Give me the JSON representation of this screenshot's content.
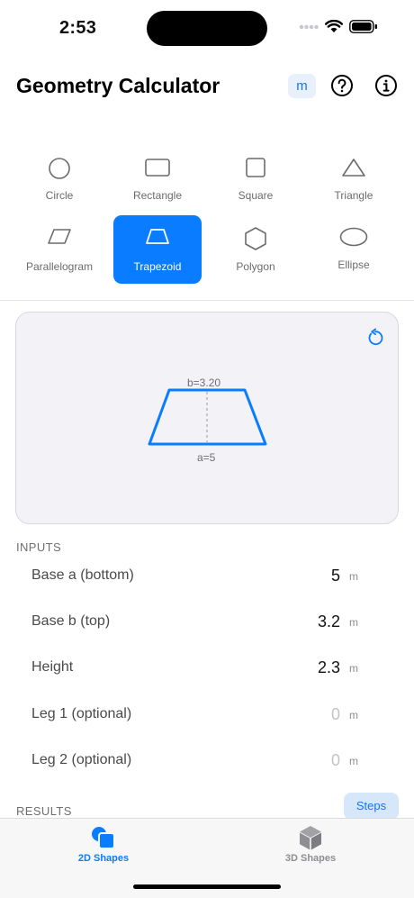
{
  "status": {
    "time": "2:53"
  },
  "header": {
    "title": "Geometry Calculator",
    "unit": "m",
    "help_icon": "question-circle-icon",
    "info_icon": "info-circle-icon"
  },
  "shapes": [
    {
      "label": "Circle",
      "icon": "circle-icon",
      "selected": false
    },
    {
      "label": "Rectangle",
      "icon": "rectangle-icon",
      "selected": false
    },
    {
      "label": "Square",
      "icon": "square-icon",
      "selected": false
    },
    {
      "label": "Triangle",
      "icon": "triangle-icon",
      "selected": false
    },
    {
      "label": "Parallelogram",
      "icon": "parallelogram-icon",
      "selected": false
    },
    {
      "label": "Trapezoid",
      "icon": "trapezoid-icon",
      "selected": true
    },
    {
      "label": "Polygon",
      "icon": "hexagon-icon",
      "selected": false
    },
    {
      "label": "Ellipse",
      "icon": "ellipse-icon",
      "selected": false
    }
  ],
  "preview": {
    "top_label": "b=3.20",
    "bottom_label": "a=5",
    "accent": "#0a7cff"
  },
  "inputs": {
    "title": "INPUTS",
    "rows": [
      {
        "label": "Base a (bottom)",
        "value": "5",
        "unit": "m"
      },
      {
        "label": "Base b (top)",
        "value": "3.2",
        "unit": "m"
      },
      {
        "label": "Height",
        "value": "2.3",
        "unit": "m"
      },
      {
        "label": "Leg 1 (optional)",
        "value": "0",
        "unit": "m",
        "placeholder": true
      },
      {
        "label": "Leg 2 (optional)",
        "value": "0",
        "unit": "m",
        "placeholder": true
      }
    ]
  },
  "results": {
    "title": "RESULTS",
    "steps_label": "Steps"
  },
  "tabs": [
    {
      "label": "2D Shapes",
      "icon": "2d-shapes-icon",
      "active": true
    },
    {
      "label": "3D Shapes",
      "icon": "cube-icon",
      "active": false
    }
  ]
}
